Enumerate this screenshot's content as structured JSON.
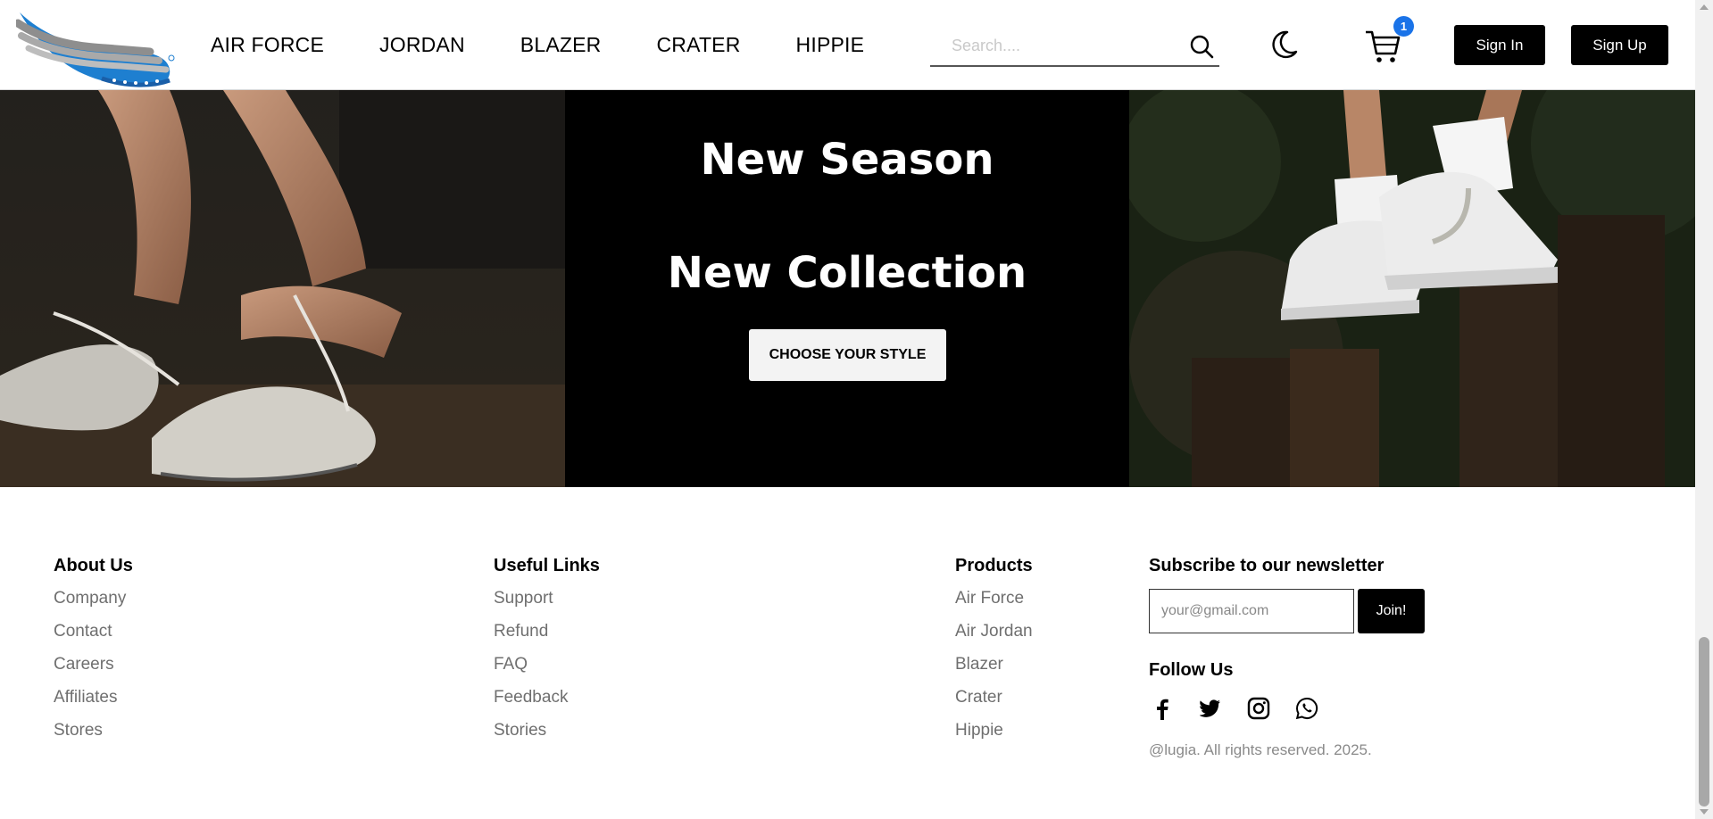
{
  "nav": {
    "links": [
      "AIR FORCE",
      "JORDAN",
      "BLAZER",
      "CRATER",
      "HIPPIE"
    ],
    "search_placeholder": "Search....",
    "cart_count": "1",
    "sign_in": "Sign In",
    "sign_up": "Sign Up"
  },
  "hero": {
    "line1": "New Season",
    "line2": "New Collection",
    "cta": "CHOOSE YOUR STYLE"
  },
  "footer": {
    "about": {
      "title": "About Us",
      "items": [
        "Company",
        "Contact",
        "Careers",
        "Affiliates",
        "Stores"
      ]
    },
    "useful": {
      "title": "Useful Links",
      "items": [
        "Support",
        "Refund",
        "FAQ",
        "Feedback",
        "Stories"
      ]
    },
    "products": {
      "title": "Products",
      "items": [
        "Air Force",
        "Air Jordan",
        "Blazer",
        "Crater",
        "Hippie"
      ]
    },
    "newsletter": {
      "title": "Subscribe to our newsletter",
      "placeholder": "your@gmail.com",
      "button": "Join!"
    },
    "follow_title": "Follow Us",
    "socials": [
      "facebook-icon",
      "twitter-icon",
      "instagram-icon",
      "whatsapp-icon"
    ],
    "copyright": "@lugia. All rights reserved. 2025."
  },
  "colors": {
    "accent": "#1a73e8",
    "logo_blue": "#1e7fd0",
    "logo_grey": "#9a9a9a"
  }
}
